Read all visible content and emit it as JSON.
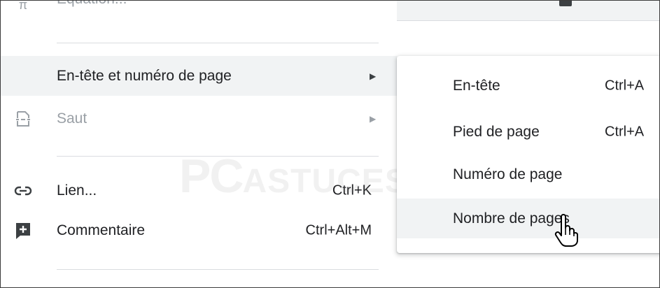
{
  "menu": {
    "top_partial_label": "Équation...",
    "items": [
      {
        "label": "En-tête et numéro de page",
        "shortcut": "",
        "icon": "",
        "has_submenu": true
      },
      {
        "label": "Saut",
        "shortcut": "",
        "icon": "page-break-icon",
        "has_submenu": true
      },
      {
        "label": "Lien...",
        "shortcut": "Ctrl+K",
        "icon": "link-icon",
        "has_submenu": false
      },
      {
        "label": "Commentaire",
        "shortcut": "Ctrl+Alt+M",
        "icon": "comment-add-icon",
        "has_submenu": false
      }
    ],
    "submenu_arrow": "▶"
  },
  "submenu": {
    "items": [
      {
        "label": "En-tête",
        "shortcut": "Ctrl+A"
      },
      {
        "label": "Pied de page",
        "shortcut": "Ctrl+A"
      },
      {
        "label": "Numéro de page",
        "shortcut": ""
      },
      {
        "label": "Nombre de pages",
        "shortcut": ""
      }
    ]
  },
  "watermark": {
    "main": "PC",
    "sub": "ASTUCES"
  },
  "colors": {
    "highlight": "#f1f3f4",
    "text": "#202124",
    "disabled": "#9aa0a6",
    "divider": "#dadce0"
  }
}
